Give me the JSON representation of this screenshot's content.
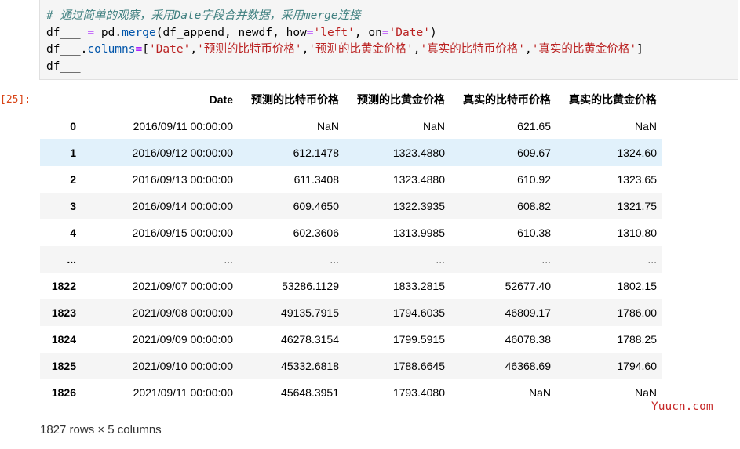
{
  "code_cell": {
    "line1_comment": "# 通过简单的观察，采用Date字段合并数据，采用merge连接",
    "line2": {
      "var": "df___",
      "eq": " = ",
      "obj": "pd.",
      "fn": "merge",
      "args_a": "(df_append, newdf, how",
      "eq2": "=",
      "how_val": "'left'",
      "args_b": ", on",
      "eq3": "=",
      "on_val": "'Date'",
      "close": ")"
    },
    "line3": {
      "prefix": "df___.",
      "attr": "columns",
      "eq": "=",
      "open": "[",
      "c1": "'Date'",
      "sep1": ",",
      "c2": "'预测的比特币价格'",
      "sep2": ",",
      "c3": "'预测的比黄金价格'",
      "sep3": ",",
      "c4": "'真实的比特币价格'",
      "sep4": ",",
      "c5": "'真实的比黄金价格'",
      "close": "]"
    },
    "line4": "df___"
  },
  "output": {
    "prompt": "[25]:",
    "columns": [
      "",
      "Date",
      "预测的比特币价格",
      "预测的比黄金价格",
      "真实的比特币价格",
      "真实的比黄金价格"
    ],
    "rows": [
      [
        "0",
        "2016/09/11 00:00:00",
        "NaN",
        "NaN",
        "621.65",
        "NaN"
      ],
      [
        "1",
        "2016/09/12 00:00:00",
        "612.1478",
        "1323.4880",
        "609.67",
        "1324.60"
      ],
      [
        "2",
        "2016/09/13 00:00:00",
        "611.3408",
        "1323.4880",
        "610.92",
        "1323.65"
      ],
      [
        "3",
        "2016/09/14 00:00:00",
        "609.4650",
        "1322.3935",
        "608.82",
        "1321.75"
      ],
      [
        "4",
        "2016/09/15 00:00:00",
        "602.3606",
        "1313.9985",
        "610.38",
        "1310.80"
      ],
      [
        "...",
        "...",
        "...",
        "...",
        "...",
        "..."
      ],
      [
        "1822",
        "2021/09/07 00:00:00",
        "53286.1129",
        "1833.2815",
        "52677.40",
        "1802.15"
      ],
      [
        "1823",
        "2021/09/08 00:00:00",
        "49135.7915",
        "1794.6035",
        "46809.17",
        "1786.00"
      ],
      [
        "1824",
        "2021/09/09 00:00:00",
        "46278.3154",
        "1799.5915",
        "46078.38",
        "1788.25"
      ],
      [
        "1825",
        "2021/09/10 00:00:00",
        "45332.6818",
        "1788.6645",
        "46368.69",
        "1794.60"
      ],
      [
        "1826",
        "2021/09/11 00:00:00",
        "45648.3951",
        "1793.4080",
        "NaN",
        "NaN"
      ]
    ],
    "highlighted_row": 1,
    "footer": "1827 rows × 5 columns"
  },
  "watermark": "Yuucn.com"
}
